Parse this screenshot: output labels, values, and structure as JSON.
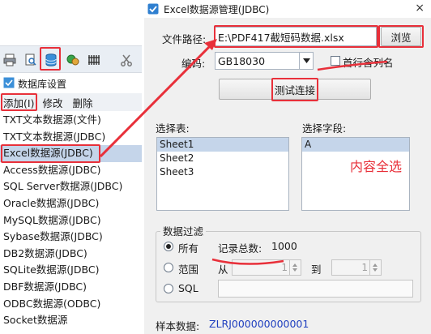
{
  "app": {
    "db_settings_label": "数据库设置",
    "menu": {
      "add": "添加(I)",
      "edit": "修改",
      "delete": "删除"
    },
    "toolbar_icons": [
      "print-icon",
      "print-preview-icon",
      "database-icon",
      "tools-icon",
      "barcode-icon",
      "cut-icon"
    ],
    "data_sources": [
      "TXT文本数据源(文件)",
      "TXT文本数据源(JDBC)",
      "Excel数据源(JDBC)",
      "Access数据源(JDBC)",
      "SQL Server数据源(JDBC)",
      "Oracle数据源(JDBC)",
      "MySQL数据源(JDBC)",
      "Sybase数据源(JDBC)",
      "DB2数据源(JDBC)",
      "SQLite数据源(JDBC)",
      "DBF数据源(JDBC)",
      "ODBC数据源(ODBC)",
      "Socket数据源"
    ],
    "selected_source_index": 2
  },
  "dialog": {
    "title": "Excel数据源管理(JDBC)",
    "close_glyph": "×",
    "file_path_label": "文件路径:",
    "file_path_value": "E:\\PDF417截短码数据.xlsx",
    "browse_label": "浏览",
    "encoding_label": "编码:",
    "encoding_value": "GB18030",
    "first_row_header_label": "首行含列名",
    "test_connection_label": "测试连接",
    "select_table_label": "选择表:",
    "select_field_label": "选择字段:",
    "tables": [
      "Sheet1",
      "Sheet2",
      "Sheet3"
    ],
    "selected_table_index": 0,
    "fields": [
      "A"
    ],
    "selected_field_index": 0,
    "filter_group_label": "数据过滤",
    "filter_all_label": "所有",
    "record_count_label": "记录总数:",
    "record_count_value": "1000",
    "filter_range_label": "范围",
    "range_from_label": "从",
    "range_from_value": "1",
    "range_to_label": "到",
    "range_to_value": "1",
    "filter_sql_label": "SQL",
    "sql_value": "",
    "sample_label": "样本数据:",
    "sample_value": "ZLRJ000000000001",
    "annotation_text": "内容全选"
  },
  "colors": {
    "annotation_red": "#e8303a",
    "selection_blue": "#c5d5ea",
    "sample_text_blue": "#1f3fbf"
  }
}
